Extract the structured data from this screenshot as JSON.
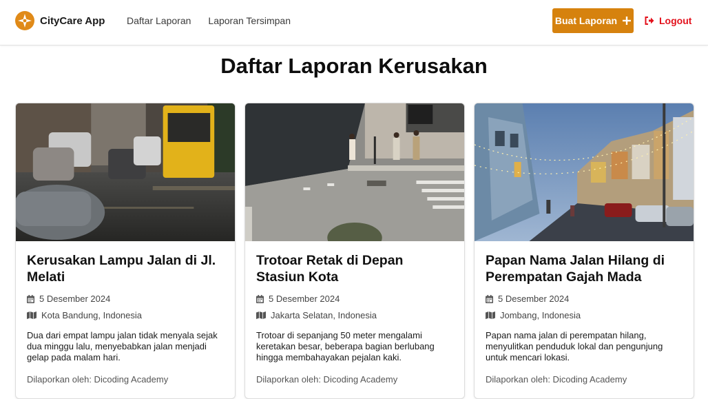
{
  "app": {
    "name": "CityCare App"
  },
  "nav": {
    "links": [
      {
        "label": "Daftar Laporan"
      },
      {
        "label": "Laporan Tersimpan"
      }
    ],
    "create_button": "Buat Laporan",
    "create_icon": "plus-icon",
    "logout": "Logout",
    "logout_icon": "logout-icon"
  },
  "colors": {
    "accent": "#d6820e",
    "logout": "#e3101b"
  },
  "page": {
    "title": "Daftar Laporan Kerusakan"
  },
  "reports": [
    {
      "title": "Kerusakan Lampu Jalan di Jl. Melati",
      "date": "5 Desember 2024",
      "location": "Kota Bandung, Indonesia",
      "description": "Dua dari empat lampu jalan tidak menyala sejak dua minggu lalu, menyebabkan jalan menjadi gelap pada malam hari.",
      "reporter": "Dilaporkan oleh: Dicoding Academy"
    },
    {
      "title": "Trotoar Retak di Depan Stasiun Kota",
      "date": "5 Desember 2024",
      "location": "Jakarta Selatan, Indonesia",
      "description": "Trotoar di sepanjang 50 meter mengalami keretakan besar, beberapa bagian berlubang hingga membahayakan pejalan kaki.",
      "reporter": "Dilaporkan oleh: Dicoding Academy"
    },
    {
      "title": "Papan Nama Jalan Hilang di Perempatan Gajah Mada",
      "date": "5 Desember 2024",
      "location": "Jombang, Indonesia",
      "description": "Papan nama jalan di perempatan hilang, menyulitkan penduduk lokal dan pengunjung untuk mencari lokasi.",
      "reporter": "Dilaporkan oleh: Dicoding Academy"
    }
  ]
}
